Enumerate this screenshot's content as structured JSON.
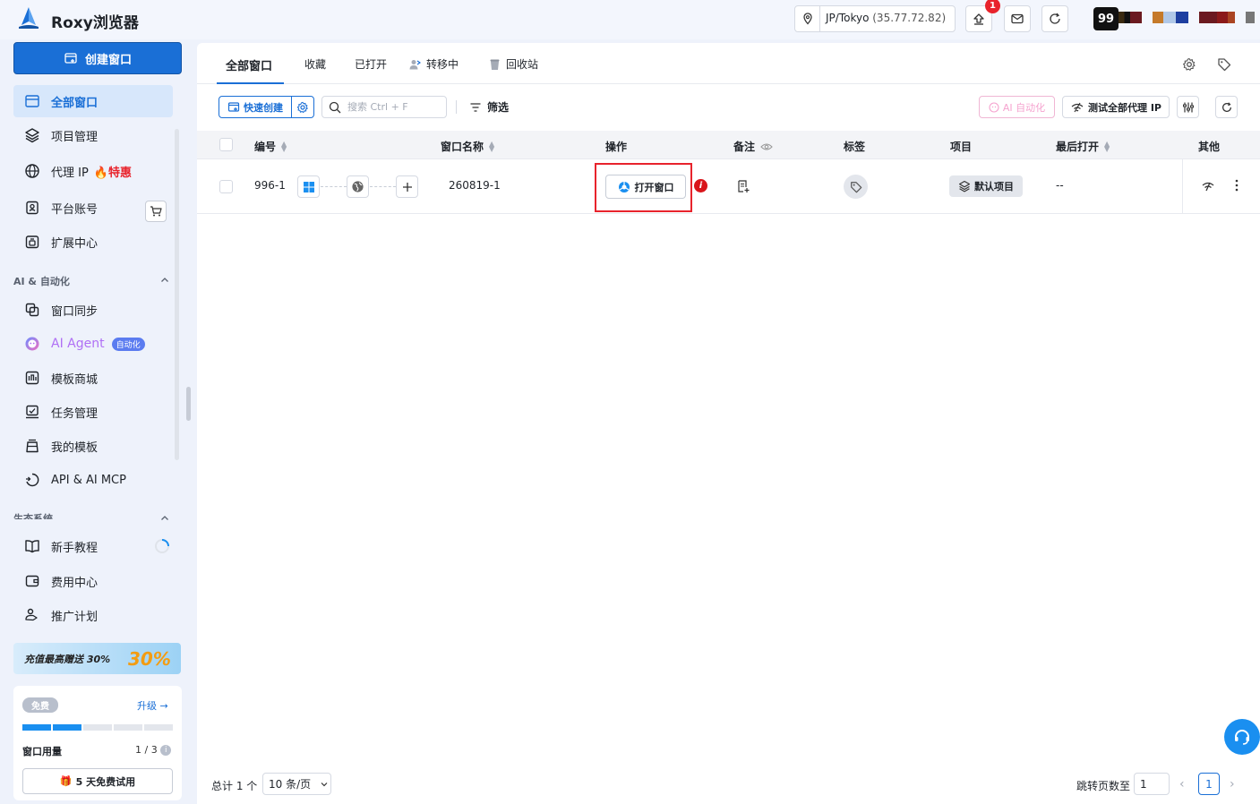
{
  "app": {
    "title": "Roxy浏览器"
  },
  "topbar": {
    "location": "JP/Tokyo",
    "ip": "(35.77.72.82)",
    "notification_count": "1",
    "avatar_text": "99"
  },
  "sidebar": {
    "create_label": "创建窗口",
    "items": [
      {
        "label": "全部窗口",
        "icon": "window-icon"
      },
      {
        "label": "项目管理",
        "icon": "layers-icon"
      },
      {
        "label": "代理 IP",
        "icon": "globe-icon",
        "hot": "特惠"
      },
      {
        "label": "平台账号",
        "icon": "account-icon"
      },
      {
        "label": "扩展中心",
        "icon": "extension-icon"
      }
    ],
    "section_ai": "AI & 自动化",
    "ai_items": [
      {
        "label": "窗口同步",
        "icon": "sync-icon"
      },
      {
        "label": "AI Agent",
        "icon": "ai-agent-icon",
        "pill": "自动化"
      },
      {
        "label": "模板商城",
        "icon": "store-icon"
      },
      {
        "label": "任务管理",
        "icon": "task-icon"
      },
      {
        "label": "我的模板",
        "icon": "template-icon"
      },
      {
        "label": "API & AI MCP",
        "icon": "api-icon"
      }
    ],
    "section_eco": "生态系统",
    "eco_items": [
      {
        "label": "新手教程",
        "icon": "book-icon"
      },
      {
        "label": "费用中心",
        "icon": "wallet-icon"
      },
      {
        "label": "推广计划",
        "icon": "promo-icon"
      }
    ],
    "promo": {
      "text": "充值最高赠送 30%",
      "badge": "30%"
    },
    "plan": {
      "badge": "免费",
      "upgrade": "升级",
      "usage_label": "窗口用量",
      "usage_value": "1 / 3",
      "usage_fraction": 0.333,
      "trial_label": "5 天免费试用"
    }
  },
  "tabs": [
    {
      "label": "全部窗口",
      "active": true
    },
    {
      "label": "收藏"
    },
    {
      "label": "已打开"
    },
    {
      "label": "转移中"
    },
    {
      "label": "回收站"
    }
  ],
  "toolbar": {
    "quick_create": "快速创建",
    "search_placeholder": "搜索 Ctrl + F",
    "filter": "筛选",
    "ai_automation": "AI 自动化",
    "test_proxy": "测试全部代理 IP"
  },
  "table": {
    "columns": [
      "编号",
      "窗口名称",
      "操作",
      "备注",
      "标签",
      "项目",
      "最后打开",
      "其他"
    ],
    "rows": [
      {
        "id": "996-1",
        "name": "260819-1",
        "action": "打开窗口",
        "project": "默认项目",
        "last_open": "--"
      }
    ]
  },
  "footer": {
    "total": "总计 1 个",
    "page_size": "10 条/页",
    "jump_label": "跳转页数至",
    "jump_value": "1",
    "current_page": "1"
  },
  "colors": {
    "primary": "#1a6fd6",
    "danger": "#e8232c",
    "ai": "#b070f5"
  }
}
